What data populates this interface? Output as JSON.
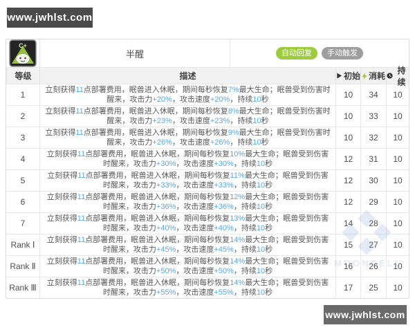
{
  "watermarks": {
    "top_left": "www.jwhlst.com",
    "bottom_right": "www.jwhlst.com",
    "center": "MOONCELL",
    "top_left_bg": "#4a4a4a",
    "bottom_right_bg": "#6a6a6a"
  },
  "skill": {
    "name": "半醒",
    "icon": "skill-icon-sleeping-beast-c-plus",
    "badges": [
      {
        "label": "自动回复",
        "color": "#9ccc3e"
      },
      {
        "label": "手动触发",
        "color": "#9e9e9e"
      }
    ]
  },
  "table": {
    "headers": {
      "level": "等级",
      "desc": "描述",
      "initial": "初始",
      "cost": "消耗",
      "duration": "持续"
    },
    "header_icons": {
      "initial": "play-icon",
      "cost": "lightning-icon",
      "duration": "clock-icon"
    },
    "desc_template": {
      "part1": "立刻获得",
      "deploy_cost_gain": "11",
      "part2": "点部署费用，眠兽进入休眠，期间每秒恢复",
      "part3": "最大生命；眠兽受到伤害时醒来，攻击力",
      "part4": "，攻击速度",
      "part5": "，持续",
      "duration_num": "10",
      "part6": "秒"
    },
    "rows": [
      {
        "level": "1",
        "regen": "7%",
        "atk": "+20%",
        "aspd": "+20%",
        "initial": "10",
        "cost": "34",
        "duration": "10"
      },
      {
        "level": "2",
        "regen": "8%",
        "atk": "+23%",
        "aspd": "+23%",
        "initial": "10",
        "cost": "33",
        "duration": "10"
      },
      {
        "level": "3",
        "regen": "9%",
        "atk": "+26%",
        "aspd": "+26%",
        "initial": "10",
        "cost": "32",
        "duration": "10"
      },
      {
        "level": "4",
        "regen": "10%",
        "atk": "+30%",
        "aspd": "+30%",
        "initial": "12",
        "cost": "31",
        "duration": "10"
      },
      {
        "level": "5",
        "regen": "11%",
        "atk": "+33%",
        "aspd": "+33%",
        "initial": "12",
        "cost": "30",
        "duration": "10"
      },
      {
        "level": "6",
        "regen": "12%",
        "atk": "+36%",
        "aspd": "+36%",
        "initial": "12",
        "cost": "29",
        "duration": "10"
      },
      {
        "level": "7",
        "regen": "13%",
        "atk": "+40%",
        "aspd": "+40%",
        "initial": "14",
        "cost": "28",
        "duration": "10"
      },
      {
        "level": "Rank Ⅰ",
        "regen": "14%",
        "atk": "+45%",
        "aspd": "+45%",
        "initial": "15",
        "cost": "27",
        "duration": "10"
      },
      {
        "level": "Rank Ⅱ",
        "regen": "14%",
        "atk": "+50%",
        "aspd": "+50%",
        "initial": "16",
        "cost": "26",
        "duration": "10"
      },
      {
        "level": "Rank Ⅲ",
        "regen": "14%",
        "atk": "+55%",
        "aspd": "+55%",
        "initial": "17",
        "cost": "25",
        "duration": "10"
      }
    ]
  },
  "colors": {
    "highlight_blue": "#54a7e9",
    "badge_green": "#9ccc3e",
    "badge_gray": "#9e9e9e",
    "lightning_green": "#a3c531"
  }
}
